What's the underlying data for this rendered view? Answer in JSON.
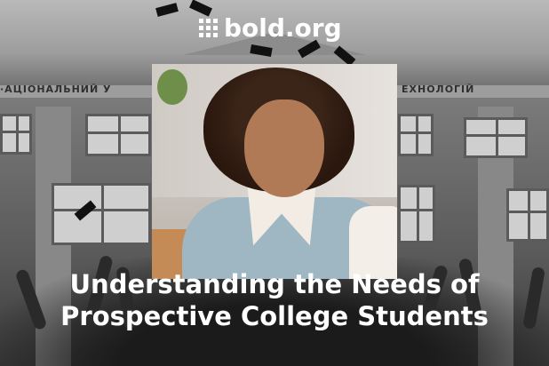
{
  "brand": {
    "name": "bold.org",
    "icon": "grid-dots-icon",
    "color": "#ffffff"
  },
  "background": {
    "building_sign_left": "·АЦІОНАЛЬНИЙ У",
    "building_sign_right": "ЕХНОЛОГІЙ"
  },
  "headline": {
    "line1": "Understanding the Needs of",
    "line2": "Prospective College Students"
  }
}
